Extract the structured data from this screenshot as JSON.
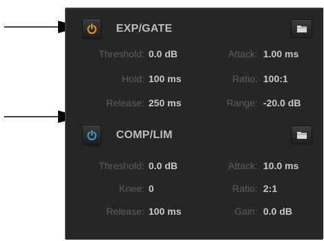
{
  "colors": {
    "panel_bg": "#262626",
    "label": "#5f5f5f",
    "value": "#c9c9c9",
    "title": "#bdbdbd",
    "exp_gate_power_active": "#f0a000",
    "comp_lim_power_active": "#3aa0e8"
  },
  "exp_gate": {
    "title": "EXP/GATE",
    "power_icon": "power-icon",
    "power_color": "#f0a000",
    "folder_icon": "folder-icon",
    "params": {
      "threshold_label": "Threshold:",
      "threshold_value": "0.0 dB",
      "attack_label": "Attack:",
      "attack_value": "1.00 ms",
      "hold_label": "Hold:",
      "hold_value": "100 ms",
      "ratio_label": "Ratio:",
      "ratio_value": "100:1",
      "release_label": "Release:",
      "release_value": "250 ms",
      "range_label": "Range:",
      "range_value": "-20.0 dB"
    }
  },
  "comp_lim": {
    "title": "COMP/LIM",
    "power_icon": "power-icon",
    "power_color": "#3aa0e8",
    "folder_icon": "folder-icon",
    "params": {
      "threshold_label": "Threshold:",
      "threshold_value": "0.0 dB",
      "attack_label": "Attack:",
      "attack_value": "10.0 ms",
      "knee_label": "Knee:",
      "knee_value": "0",
      "ratio_label": "Ratio:",
      "ratio_value": "2:1",
      "release_label": "Release:",
      "release_value": "100 ms",
      "gain_label": "Gain:",
      "gain_value": "0.0 dB"
    }
  }
}
